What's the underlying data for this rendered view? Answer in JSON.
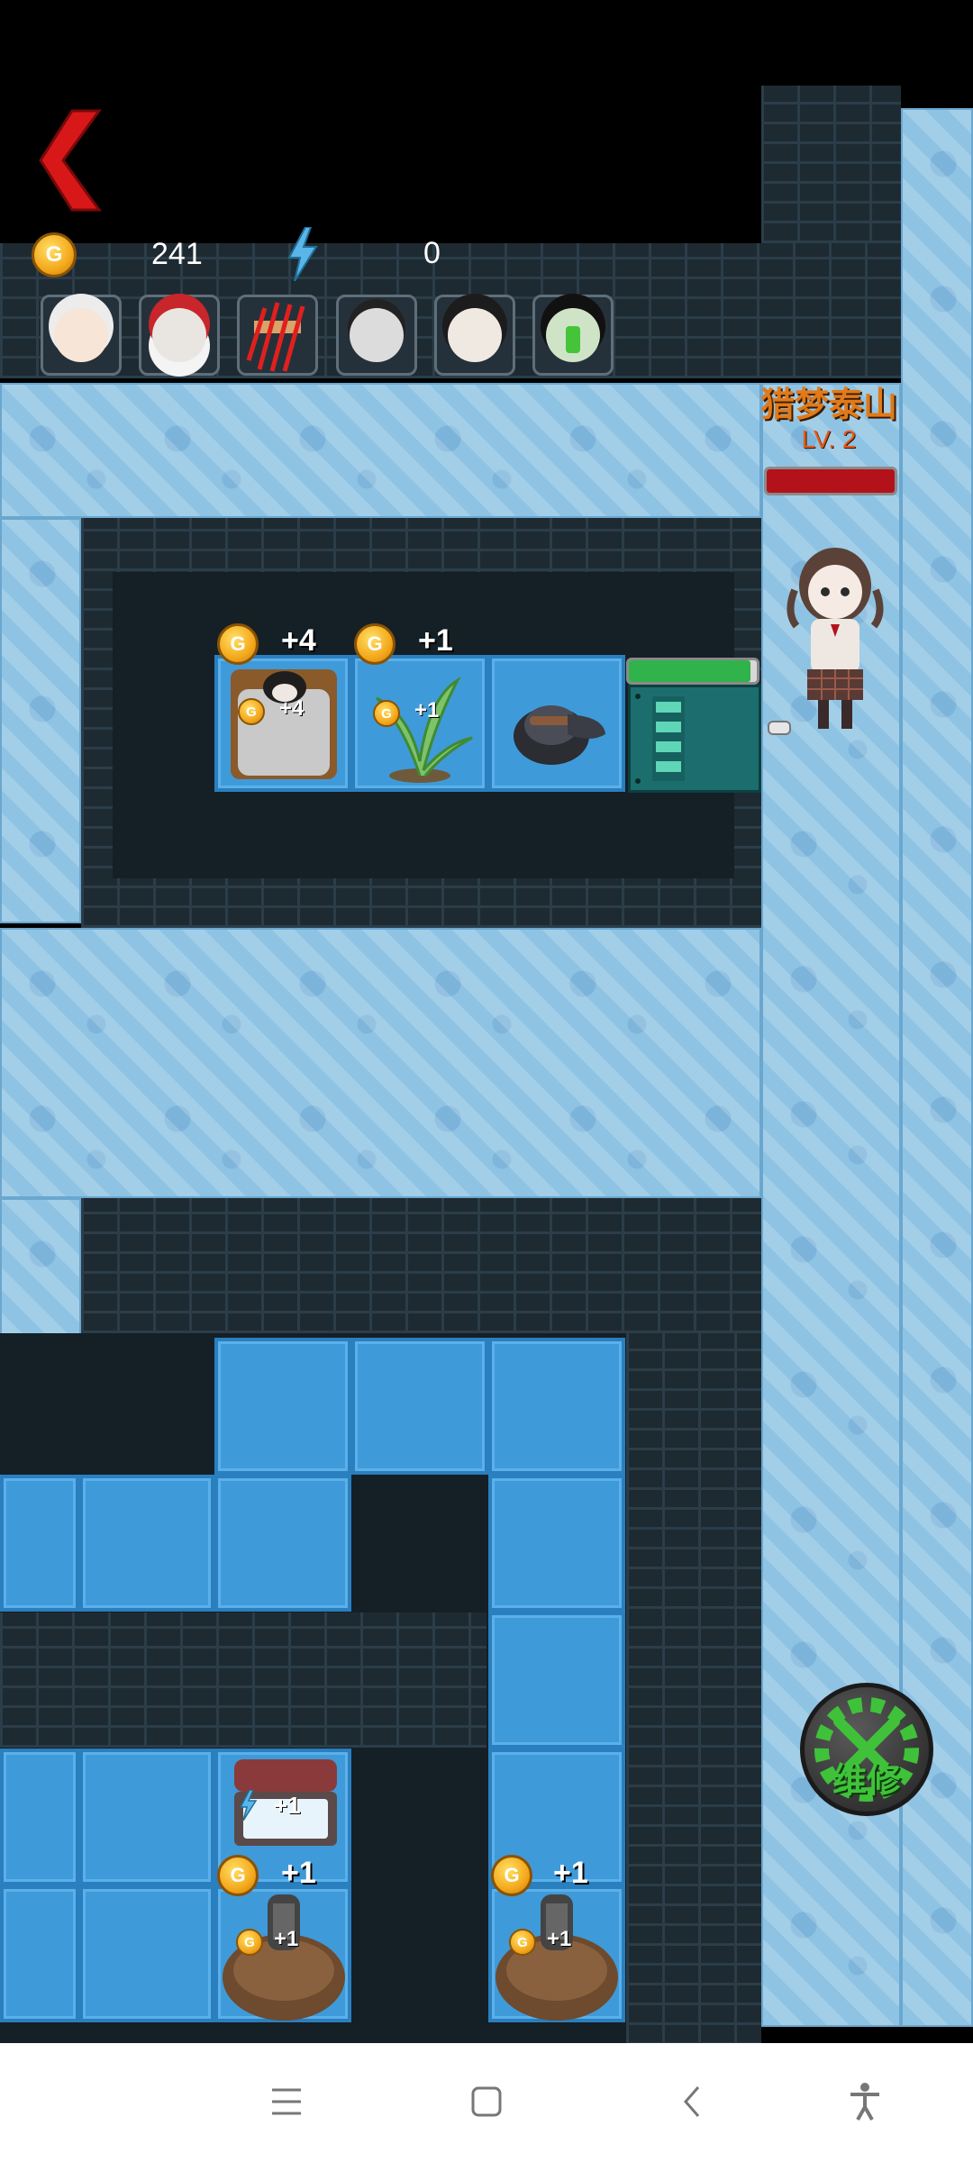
{
  "hud": {
    "coins": "241",
    "energy": "0"
  },
  "avatars": [
    {
      "name": "grandma"
    },
    {
      "name": "santa"
    },
    {
      "name": "clawed"
    },
    {
      "name": "pale-man"
    },
    {
      "name": "headphone-girl"
    },
    {
      "name": "zombie"
    }
  ],
  "enemy": {
    "name": "猎梦泰山",
    "level": "LV. 2",
    "hp_fraction": 1.0,
    "name_color": "#e07a1a",
    "hp_color": "#b3121b"
  },
  "door": {
    "hp_fraction": 0.95,
    "hp_color": "#2fb34a"
  },
  "room_top": {
    "bed_income": "+4",
    "bed_income_small": "+4",
    "plant_income": "+1",
    "plant_income_small": "+1"
  },
  "room_bottom": {
    "chest_energy": "+1",
    "grave1_income": "+1",
    "grave1_income_small": "+1",
    "grave2_income": "+1",
    "grave2_income_small": "+1"
  },
  "repair_button": {
    "label": "维修",
    "color": "#3fc23a"
  },
  "coin_glyph": "G",
  "colors": {
    "back_arrow": "#d81818",
    "tile_blue": "#3f9ad9",
    "ice": "#8fc3e3"
  },
  "navbar": {
    "icons": [
      "menu-icon",
      "home-icon",
      "back-icon",
      "accessibility-icon"
    ]
  }
}
